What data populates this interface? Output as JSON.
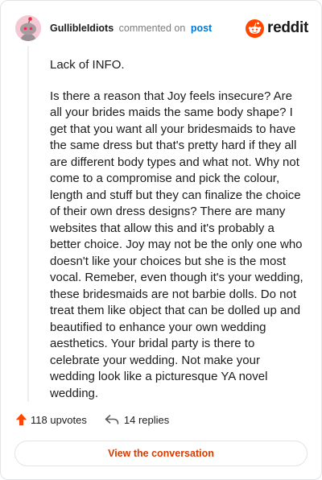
{
  "colors": {
    "brand": "#ff4500",
    "link": "#0079d3",
    "upvote": "#ff4500",
    "button_text": "#d93a00"
  },
  "header": {
    "username": "GullibleIdiots",
    "action": "commented on",
    "post_link": "post",
    "brand_logo": "reddit-logo",
    "brand_name": "reddit"
  },
  "comment": {
    "paragraphs": [
      "Lack of INFO.",
      "Is there a reason that Joy feels insecure? Are all your brides maids the same body shape? I get that you want all your bridesmaids to have the same dress but that's pretty hard if they all are different body types and what not. Why not come to a compromise and pick the colour, length and stuff but they can finalize the choice of their own dress designs? There are many websites that allow this and it's probably a better choice. Joy may not be the only one who doesn't like your choices but she is the most vocal. Remeber, even though it's your wedding, these bridesmaids are not barbie dolls. Do not treat them like object that can be dolled up and beautified to enhance your own wedding aesthetics. Your bridal party is there to celebrate your wedding. Not make your wedding look like a picturesque YA novel wedding."
    ]
  },
  "stats": {
    "upvotes": "118 upvotes",
    "replies": "14 replies",
    "upvote_icon": "upvote-arrow-icon",
    "reply_icon": "reply-arrow-icon"
  },
  "actions": {
    "view_conversation": "View the conversation"
  }
}
